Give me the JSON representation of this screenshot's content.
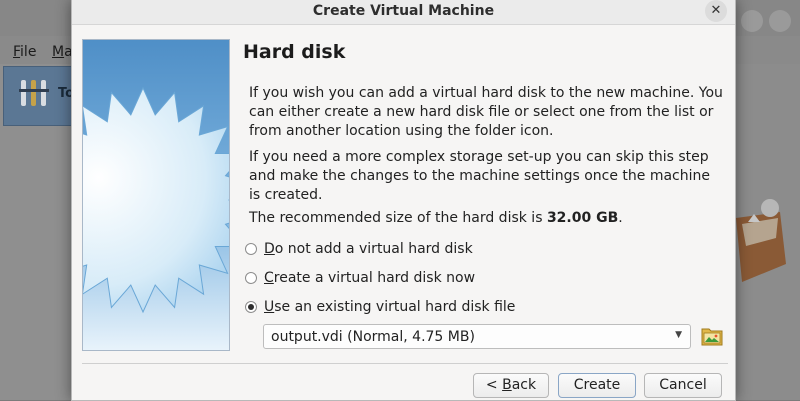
{
  "background_window": {
    "menu": [
      {
        "prefix": "",
        "mnemonic": "F",
        "rest": "ile"
      },
      {
        "prefix": "",
        "mnemonic": "M",
        "rest": "a"
      }
    ],
    "tools_label": "To"
  },
  "dialog": {
    "title": "Create Virtual Machine",
    "page_title": "Hard disk",
    "para1": "If you wish you can add a virtual hard disk to the new machine. You can either create a new hard disk file or select one from the list or from another location using the folder icon.",
    "para2": "If you need a more complex storage set-up you can skip this step and make the changes to the machine settings once the machine is created.",
    "recommended_prefix": "The recommended size of the hard disk is ",
    "recommended_size": "32.00 GB",
    "recommended_suffix": ".",
    "options": [
      {
        "mnemonic": "D",
        "rest": "o not add a virtual hard disk",
        "checked": false
      },
      {
        "mnemonic": "C",
        "rest": "reate a virtual hard disk now",
        "checked": false
      },
      {
        "mnemonic": "U",
        "rest": "se an existing virtual hard disk file",
        "checked": true
      }
    ],
    "disk_select_value": "output.vdi (Normal, 4.75 MB)",
    "buttons": {
      "back_prefix": "< ",
      "back_mnemonic": "B",
      "back_rest": "ack",
      "create": "Create",
      "cancel": "Cancel"
    },
    "icons": {
      "close": "close-icon",
      "dropdown": "chevron-down-icon",
      "folder": "folder-icon"
    },
    "colors": {
      "wizard_gradient_top": "#4f8fc7",
      "wizard_gradient_bottom": "#e8f3fb"
    }
  }
}
